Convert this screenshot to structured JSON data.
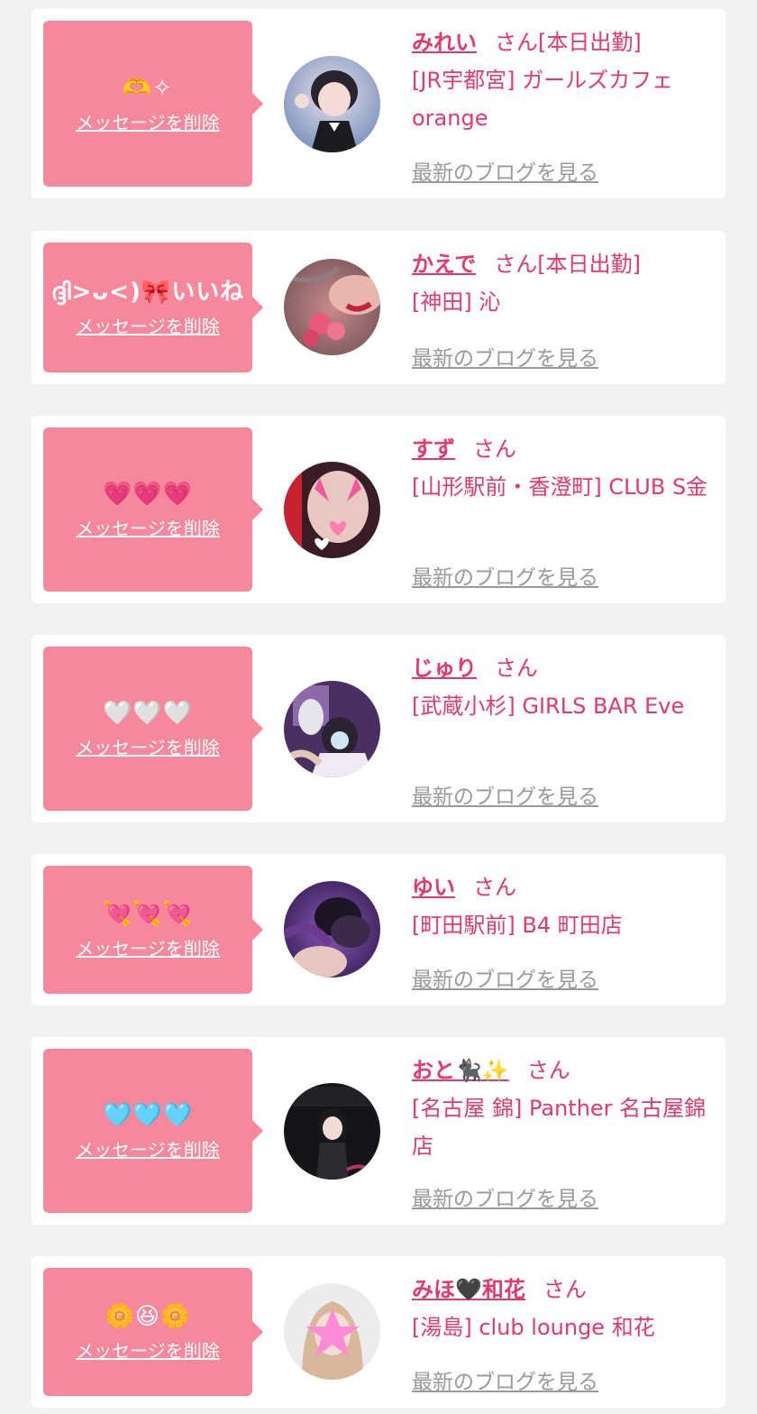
{
  "colors": {
    "background": "#f2f2f2",
    "card": "#ffffff",
    "bubble": "#f7889b",
    "accent": "#e23a6b",
    "muted": "#9a9a9a"
  },
  "common": {
    "san": "さん",
    "delete_label": "メッセージを削除",
    "blog_label": "最新のブログを見る"
  },
  "cards": [
    {
      "message": "🫶✧",
      "name": "みれい",
      "after_name": "[本日出勤]",
      "shop": "[JR宇都宮] ガールズカフェ orange"
    },
    {
      "message": "ദ്ദി>ᴗ<)🎀いいね",
      "name": "かえで",
      "after_name": "[本日出勤]",
      "shop": "[神田] 沁"
    },
    {
      "message": "💗💗💗",
      "name": "すず",
      "after_name": "",
      "shop": "[山形駅前・香澄町] CLUB S金"
    },
    {
      "message": "🤍🤍🤍",
      "name": "じゅり",
      "after_name": "",
      "shop": "[武蔵小杉] GIRLS BAR Eve"
    },
    {
      "message": "💘💘💘",
      "name": "ゆい",
      "after_name": "",
      "shop": "[町田駅前] B4 町田店"
    },
    {
      "message": "🩵🩵🩵",
      "name": "おと🐈‍⬛✨",
      "after_name": "",
      "shop": "[名古屋 錦] Panther 名古屋錦店"
    },
    {
      "message": "🌼😆🌼",
      "name": "みほ🖤和花",
      "after_name": "",
      "shop": "[湯島] club lounge 和花"
    }
  ]
}
